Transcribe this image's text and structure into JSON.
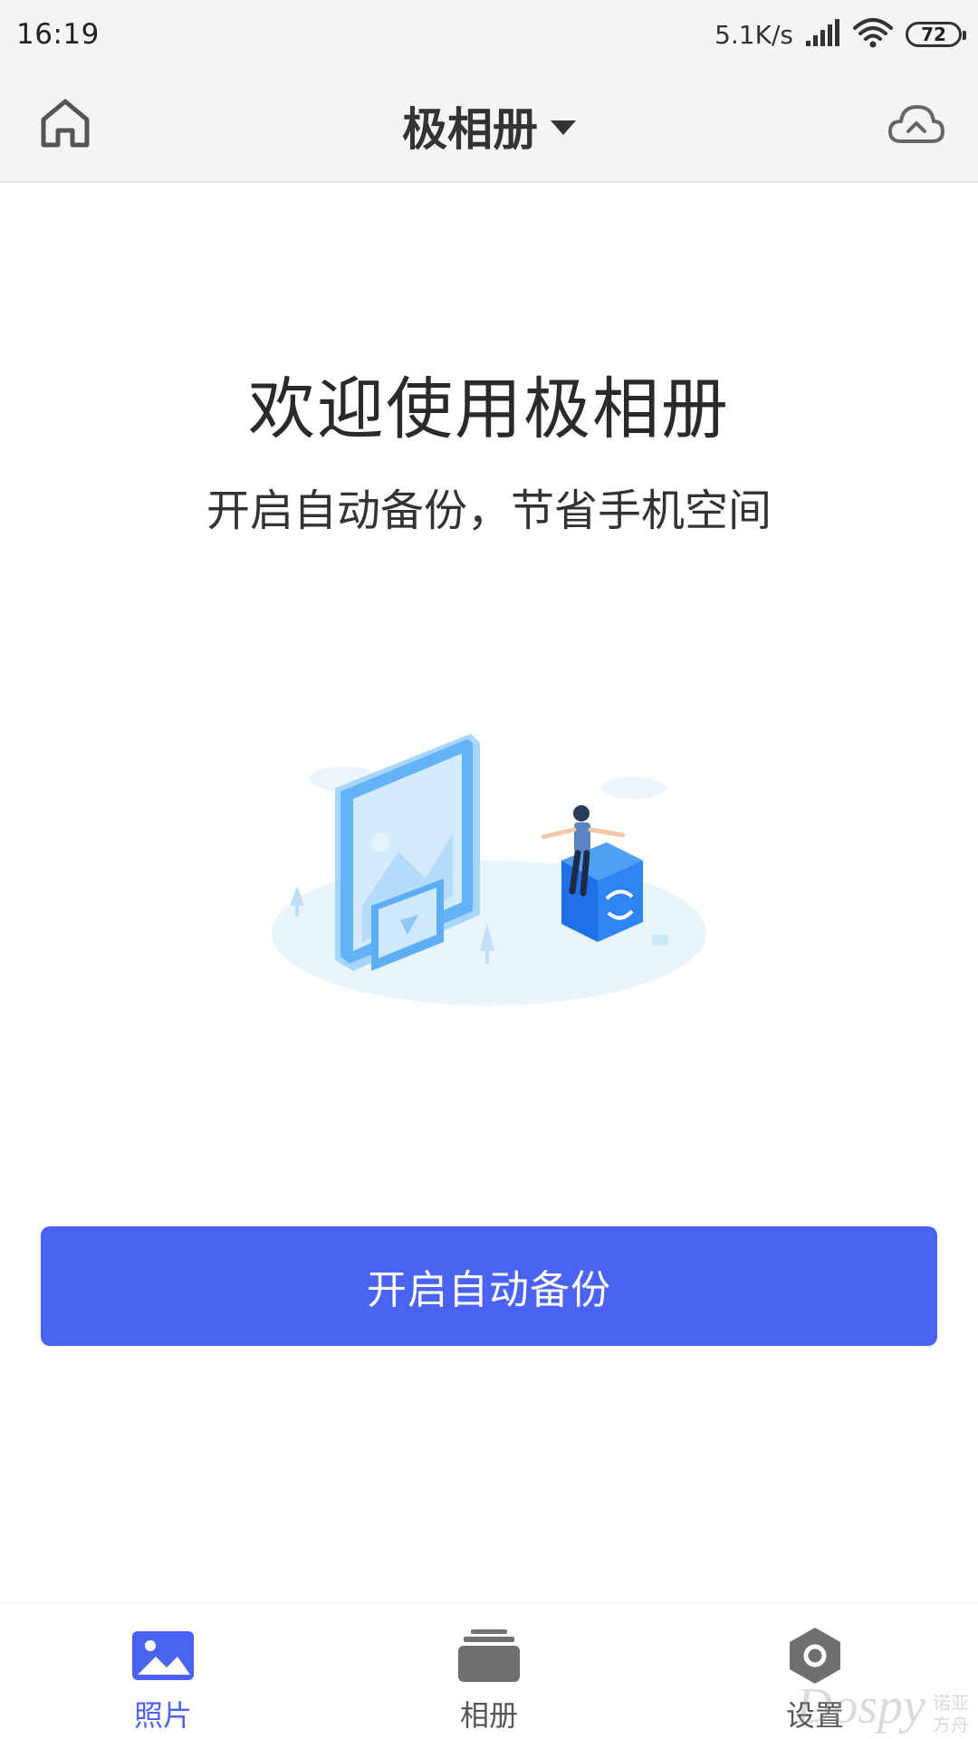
{
  "status_bar": {
    "time": "16:19",
    "speed": "5.1K/s",
    "battery": "72",
    "signal_icon": "cellular-signal-icon",
    "wifi_icon": "wifi-icon"
  },
  "app_bar": {
    "title": "极相册",
    "home_icon": "home-icon",
    "cloud_icon": "cloud-upload-icon",
    "dropdown_icon": "caret-down-icon"
  },
  "welcome": {
    "title": "欢迎使用极相册",
    "subtitle": "开启自动备份，节省手机空间"
  },
  "primary_action": {
    "label": "开启自动备份"
  },
  "bottom_nav": {
    "items": [
      {
        "label": "照片",
        "icon": "photo-icon",
        "active": true
      },
      {
        "label": "相册",
        "icon": "album-stack-icon",
        "active": false
      },
      {
        "label": "设置",
        "icon": "settings-hexagon-icon",
        "active": false
      }
    ]
  },
  "watermark": {
    "main": "Dospy",
    "side_top": "诺亚",
    "side_bottom": "方舟"
  },
  "colors": {
    "accent": "#4b63f3",
    "bar_bg": "#f5f5f5",
    "icon_gray": "#707070"
  }
}
